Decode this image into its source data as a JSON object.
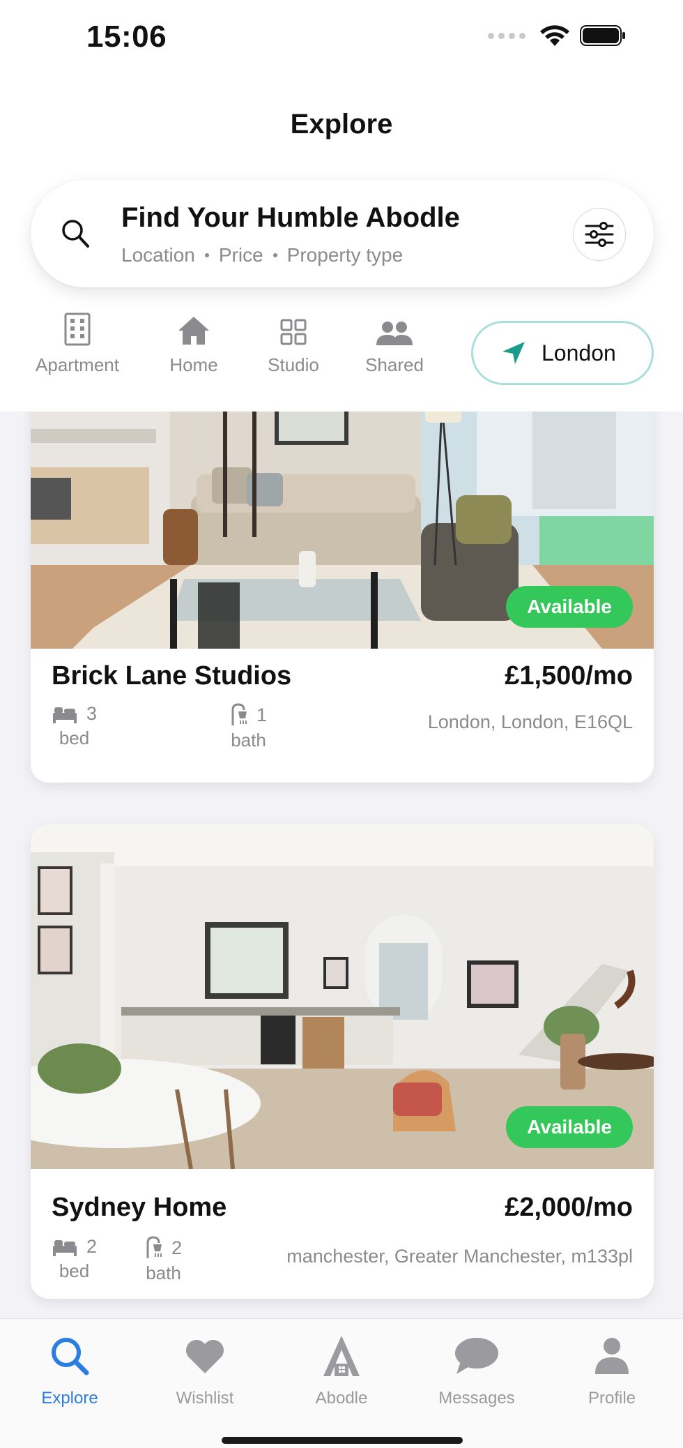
{
  "status_bar": {
    "time": "15:06"
  },
  "header": {
    "title": "Explore"
  },
  "search": {
    "title": "Find Your Humble Abodle",
    "filters": [
      "Location",
      "Price",
      "Property type"
    ]
  },
  "categories": [
    {
      "label": "Apartment",
      "icon": "building-icon"
    },
    {
      "label": "Home",
      "icon": "house-icon"
    },
    {
      "label": "Studio",
      "icon": "grid-icon"
    },
    {
      "label": "Shared",
      "icon": "people-icon"
    }
  ],
  "location": {
    "label": "London",
    "icon": "location-arrow-icon"
  },
  "listings": [
    {
      "title": "Brick Lane Studios",
      "price": "£1,500/mo",
      "badge": "Available",
      "beds": "3",
      "bed_label": "bed",
      "baths": "1",
      "bath_label": "bath",
      "address": "London, London, E16QL"
    },
    {
      "title": "Sydney Home",
      "price": "£2,000/mo",
      "badge": "Available",
      "beds": "2",
      "bed_label": "bed",
      "baths": "2",
      "bath_label": "bath",
      "address": "manchester, Greater Manchester, m133pl"
    }
  ],
  "tab_bar": {
    "tabs": [
      {
        "label": "Explore",
        "icon": "search-icon",
        "active": true
      },
      {
        "label": "Wishlist",
        "icon": "heart-icon",
        "active": false
      },
      {
        "label": "Abodle",
        "icon": "abodle-house-icon",
        "active": false
      },
      {
        "label": "Messages",
        "icon": "chat-bubble-icon",
        "active": false
      },
      {
        "label": "Profile",
        "icon": "person-icon",
        "active": false
      }
    ]
  },
  "colors": {
    "accent": "#2a7de1",
    "available": "#34c759",
    "location_arrow": "#1a9b8c",
    "location_border": "#a9dfd9"
  }
}
